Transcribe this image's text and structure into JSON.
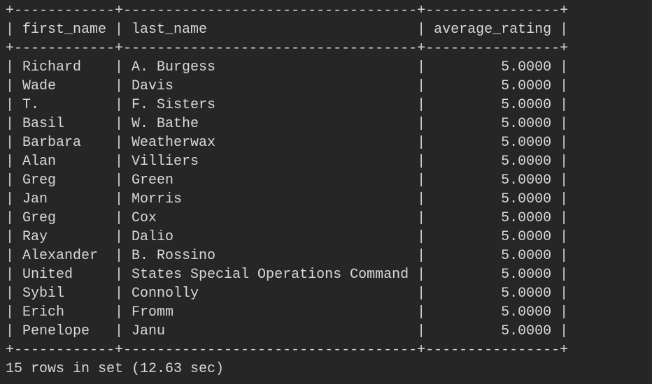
{
  "table": {
    "columns": [
      "first_name",
      "last_name",
      "average_rating"
    ],
    "rows": [
      [
        "Richard",
        "A. Burgess",
        "5.0000"
      ],
      [
        "Wade",
        "Davis",
        "5.0000"
      ],
      [
        "T.",
        "F. Sisters",
        "5.0000"
      ],
      [
        "Basil",
        "W. Bathe",
        "5.0000"
      ],
      [
        "Barbara",
        "Weatherwax",
        "5.0000"
      ],
      [
        "Alan",
        "Villiers",
        "5.0000"
      ],
      [
        "Greg",
        "Green",
        "5.0000"
      ],
      [
        "Jan",
        "Morris",
        "5.0000"
      ],
      [
        "Greg",
        "Cox",
        "5.0000"
      ],
      [
        "Ray",
        "Dalio",
        "5.0000"
      ],
      [
        "Alexander",
        "B. Rossino",
        "5.0000"
      ],
      [
        "United",
        "States Special Operations Command",
        "5.0000"
      ],
      [
        "Sybil",
        "Connolly",
        "5.0000"
      ],
      [
        "Erich",
        "Fromm",
        "5.0000"
      ],
      [
        "Penelope",
        "Janu",
        "5.0000"
      ]
    ]
  },
  "status": "15 rows in set (12.63 sec)"
}
